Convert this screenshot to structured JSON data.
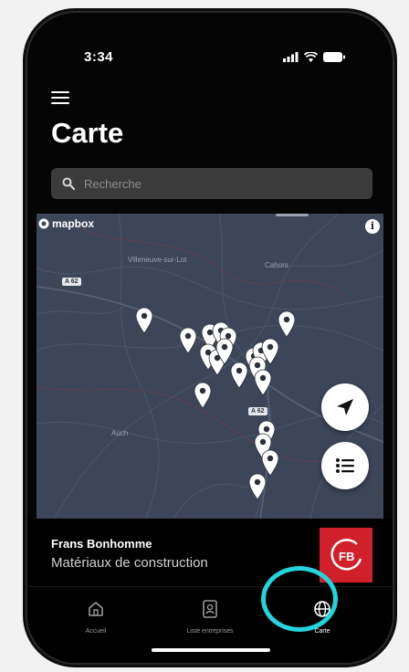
{
  "status_bar": {
    "time": "3:34"
  },
  "header": {
    "title": "Carte"
  },
  "search": {
    "placeholder": "Recherche"
  },
  "map": {
    "attribution": "mapbox",
    "info": "i",
    "towns": [
      "Villeneuve-sur-Lot",
      "Cahors",
      "Auch"
    ],
    "road_labels": [
      "A 62",
      "A 62"
    ],
    "colors": {
      "background": "#3c4658",
      "pin": "#ffffff"
    }
  },
  "selected_company": {
    "name": "Frans Bonhomme",
    "category": "Matériaux de construction",
    "logo_text": "FB",
    "logo_color": "#d0202a"
  },
  "tabs": [
    {
      "label": "Accueil",
      "icon": "home-icon",
      "active": false
    },
    {
      "label": "Liste entreprises",
      "icon": "contacts-icon",
      "active": false
    },
    {
      "label": "Carte",
      "icon": "globe-icon",
      "active": true
    }
  ],
  "highlight_color": "#23d3dd"
}
